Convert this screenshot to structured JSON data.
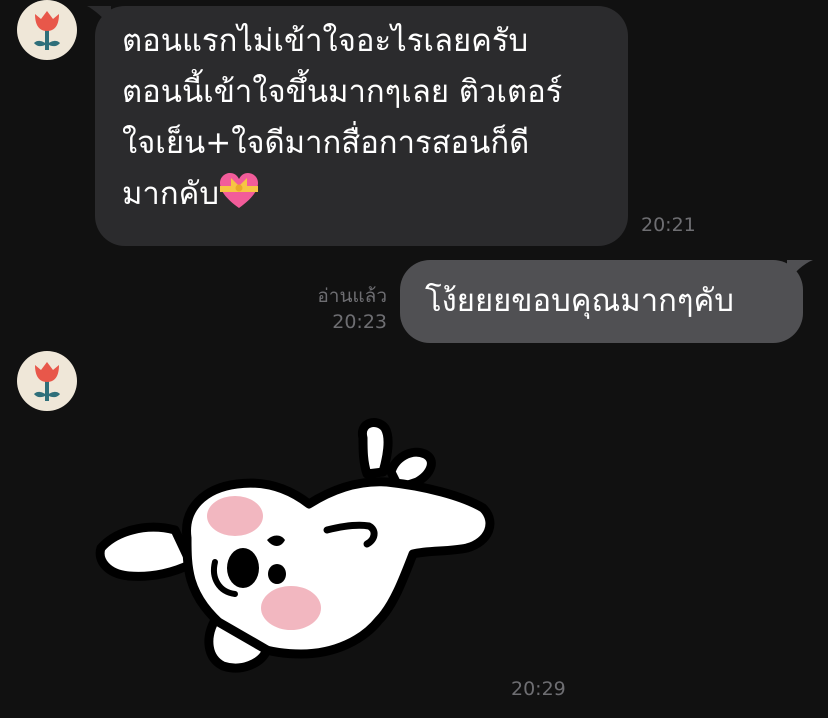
{
  "conversation": {
    "messages": [
      {
        "direction": "incoming",
        "lines": [
          "ตอนแรกไม่เข้าใจอะไรเลยครับ",
          "ตอนนี้เข้าใจขึ้นมากๆเลย ติวเตอร์",
          "ใจเย็น+ใจดีมากสื่อการสอนก็ดี",
          "มากคับ"
        ],
        "emoji": "heart-with-ribbon-icon",
        "time": "20:21"
      },
      {
        "direction": "outgoing",
        "text": "โง้ยยยขอบคุณมากๆคับ",
        "read_label": "อ่านแล้ว",
        "time": "20:23"
      },
      {
        "direction": "incoming",
        "type": "sticker",
        "sticker": "puppy-lying-on-back-sticker",
        "time": "20:29"
      }
    ]
  },
  "avatar": {
    "icon": "red-flower-icon"
  },
  "colors": {
    "background": "#111111",
    "incoming_bubble": "#2b2b2d",
    "outgoing_bubble": "#505053",
    "timestamp": "#6e6e72",
    "avatar_bg": "#efe7d8",
    "flower": "#e8574a",
    "stem": "#2f6f7a"
  }
}
